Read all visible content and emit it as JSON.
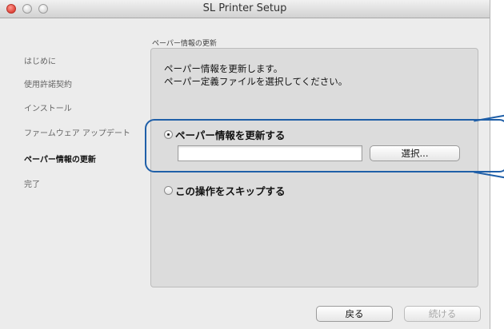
{
  "window": {
    "title": "SL Printer Setup"
  },
  "sidebar": {
    "items": [
      {
        "label": "はじめに",
        "active": false
      },
      {
        "label": "使用許諾契約",
        "active": false
      },
      {
        "label": "インストール",
        "active": false
      },
      {
        "label": "ファームウェア アップデート",
        "active": false
      },
      {
        "label": "ペーパー情報の更新",
        "active": true
      },
      {
        "label": "完了",
        "active": false
      }
    ]
  },
  "main": {
    "section_label": "ペーパー情報の更新",
    "description_line1": "ペーパー情報を更新します。",
    "description_line2": "ペーパー定義ファイルを選択してください。",
    "option_update": {
      "label": "ペーパー情報を更新する",
      "selected": true
    },
    "file_path": {
      "value": "",
      "placeholder": ""
    },
    "select_button_label": "選択...",
    "option_skip": {
      "label": "この操作をスキップする",
      "selected": false
    }
  },
  "footer": {
    "back_label": "戻る",
    "continue_label": "続ける",
    "continue_enabled": false
  },
  "colors": {
    "highlight": "#1f5fa8",
    "close_button": "#e0443a"
  }
}
